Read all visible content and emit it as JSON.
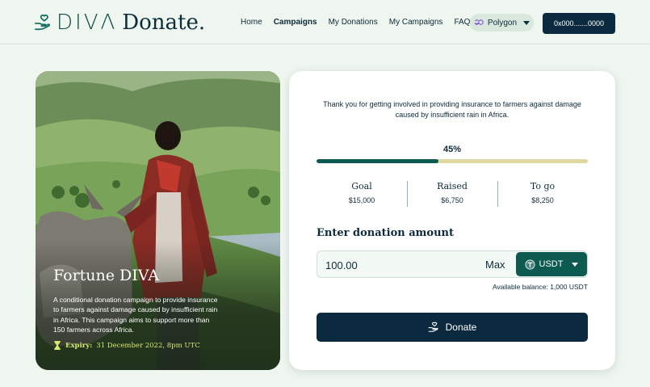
{
  "brand": {
    "logo_diva": "DIVΛ",
    "logo_donate": "Donate."
  },
  "nav": {
    "items": [
      "Home",
      "Campaigns",
      "My Donations",
      "My Campaigns",
      "FAQs"
    ],
    "active_index": 1
  },
  "network": {
    "label": "Polygon",
    "icon": "polygon-icon"
  },
  "wallet": {
    "address": "0x000.......0000"
  },
  "campaign": {
    "title": "Fortune DIVA",
    "description": "A conditional donation campaign to provide insurance to farmers against damage caused by insufficient rain in Africa. This campaign aims to support more than 150 farmers across Africa.",
    "expiry_label": "Expiry:",
    "expiry_value": "31 December 2022, 8pm UTC"
  },
  "donation": {
    "intro": "Thank you for getting involved in providing insurance to farmers against damage caused by insufficient rain in Africa.",
    "progress_text": "45%",
    "progress_fraction": 0.45,
    "stats": [
      {
        "label": "Goal",
        "value": "$15,000"
      },
      {
        "label": "Raised",
        "value": "$6,750"
      },
      {
        "label": "To go",
        "value": "$8,250"
      }
    ],
    "amount_label": "Enter donation amount",
    "amount_value": "100.00",
    "max_label": "Max",
    "token": "USDT",
    "balance": "Available balance: 1,000 USDT",
    "donate_label": "Donate"
  },
  "colors": {
    "background": "#eef6ef",
    "primary_dark": "#0b2a3f",
    "accent_green": "#0c5a50",
    "progress_track": "#ddd9a0",
    "expiry_text": "#d9e86b"
  }
}
